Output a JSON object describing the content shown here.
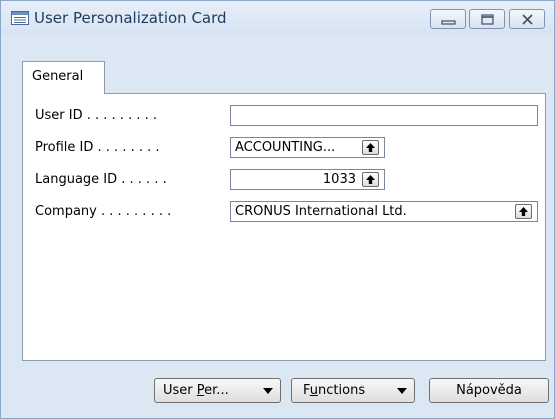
{
  "window": {
    "title": "User Personalization Card",
    "icon": "card-form-icon"
  },
  "titlebar_buttons": {
    "minimize_icon": "minimize-icon",
    "maximize_icon": "maximize-icon",
    "close_icon": "close-icon"
  },
  "tabs": [
    {
      "label": "General",
      "active": true
    }
  ],
  "fields": {
    "user_id": {
      "label": "User ID . . . . . . . . .",
      "value": ""
    },
    "profile_id": {
      "label": "Profile ID . . . . . . . .",
      "value": "ACCOUNTING...",
      "lookup_icon": "lookup-arrow-icon"
    },
    "language_id": {
      "label": "Language ID . . . . . .",
      "value": "1033",
      "lookup_icon": "lookup-arrow-icon"
    },
    "company": {
      "label": "Company . . . . . . . . .",
      "value": "CRONUS International Ltd.",
      "lookup_icon": "lookup-arrow-icon"
    }
  },
  "buttons": {
    "user_per": {
      "label": "User Per...",
      "mnemonic": "P",
      "dropdown": true
    },
    "functions": {
      "label": "Functions",
      "mnemonic": "u",
      "dropdown": true
    },
    "help": {
      "label": "Nápověda"
    }
  },
  "colors": {
    "window_bg": "#dce7f4",
    "title_text": "#1e3a5f",
    "field_border": "#7a8799"
  }
}
